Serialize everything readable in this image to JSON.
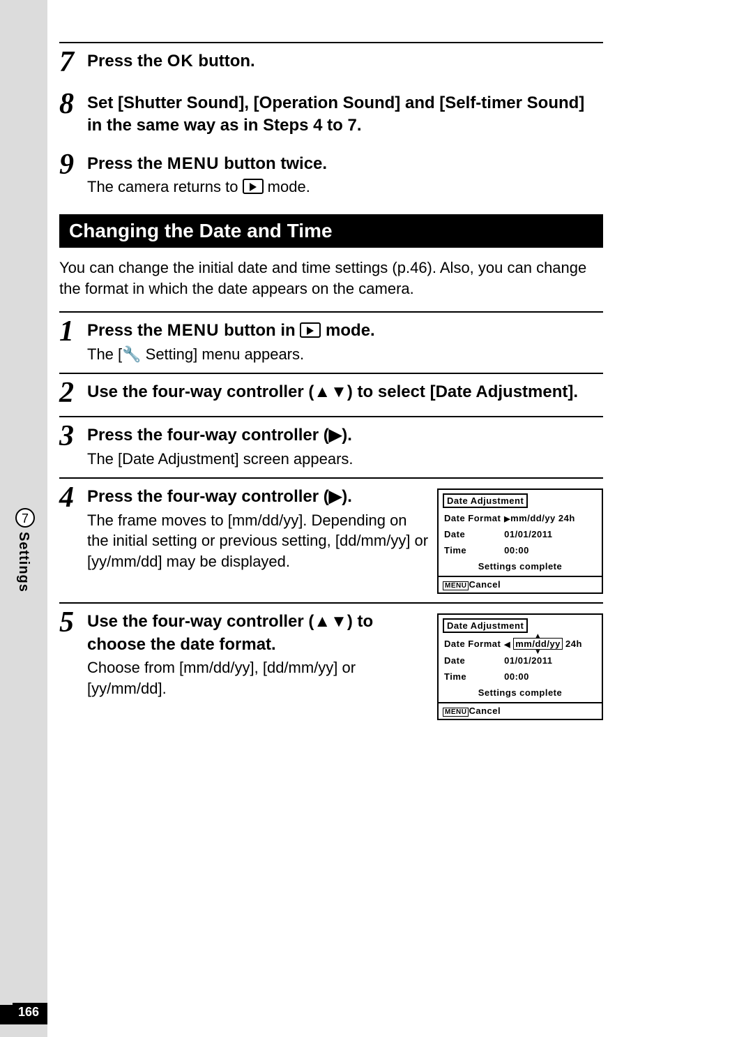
{
  "page_number": "166",
  "side_tab": {
    "chapter_number": "7",
    "chapter_label": "Settings"
  },
  "top_steps": [
    {
      "num": "7",
      "parts": [
        "Press the ",
        "OK",
        " button."
      ]
    },
    {
      "num": "8",
      "title": "Set [Shutter Sound], [Operation Sound] and [Self-timer Sound] in the same way as in Steps 4 to 7."
    },
    {
      "num": "9",
      "parts": [
        "Press the ",
        "MENU",
        " button twice."
      ],
      "desc_parts": [
        "The camera returns to ",
        "PLAY_ICON",
        " mode."
      ]
    }
  ],
  "section": {
    "header": "Changing the Date and Time",
    "intro": "You can change the initial date and time settings (p.46). Also, you can change the format in which the date appears on the camera."
  },
  "steps": [
    {
      "num": "1",
      "parts": [
        "Press the ",
        "MENU",
        " button in ",
        "PLAY_ICON",
        " mode."
      ],
      "desc": "The [🔧 Setting] menu appears."
    },
    {
      "num": "2",
      "title": "Use the four-way controller (▲▼) to select [Date Adjustment]."
    },
    {
      "num": "3",
      "title": "Press the four-way controller (▶).",
      "desc": "The [Date Adjustment] screen appears."
    },
    {
      "num": "4",
      "title": "Press the four-way controller (▶).",
      "desc": "The frame moves to [mm/dd/yy]. Depending on the initial setting or previous setting, [dd/mm/yy] or [yy/mm/dd] may be displayed.",
      "screen": {
        "title": "Date Adjustment",
        "date_format_label": "Date Format",
        "date_format_value": "mm/dd/yy 24h",
        "date_format_prefix": "▶",
        "date_label": "Date",
        "date_value": "01/01/2011",
        "time_label": "Time",
        "time_value": "00:00",
        "settings_complete": "Settings complete",
        "menu_label": "MENU",
        "cancel": "Cancel",
        "selection_boxed": false
      }
    },
    {
      "num": "5",
      "title": "Use the four-way controller (▲▼) to choose the date format.",
      "desc": "Choose from [mm/dd/yy], [dd/mm/yy] or [yy/mm/dd].",
      "screen": {
        "title": "Date Adjustment",
        "date_format_label": "Date Format",
        "date_format_value": "mm/dd/yy",
        "date_format_suffix": " 24h",
        "date_format_prefix_left": "◀",
        "date_label": "Date",
        "date_value": "01/01/2011",
        "time_label": "Time",
        "time_value": "00:00",
        "settings_complete": "Settings complete",
        "menu_label": "MENU",
        "cancel": "Cancel",
        "selection_boxed": true
      }
    }
  ]
}
